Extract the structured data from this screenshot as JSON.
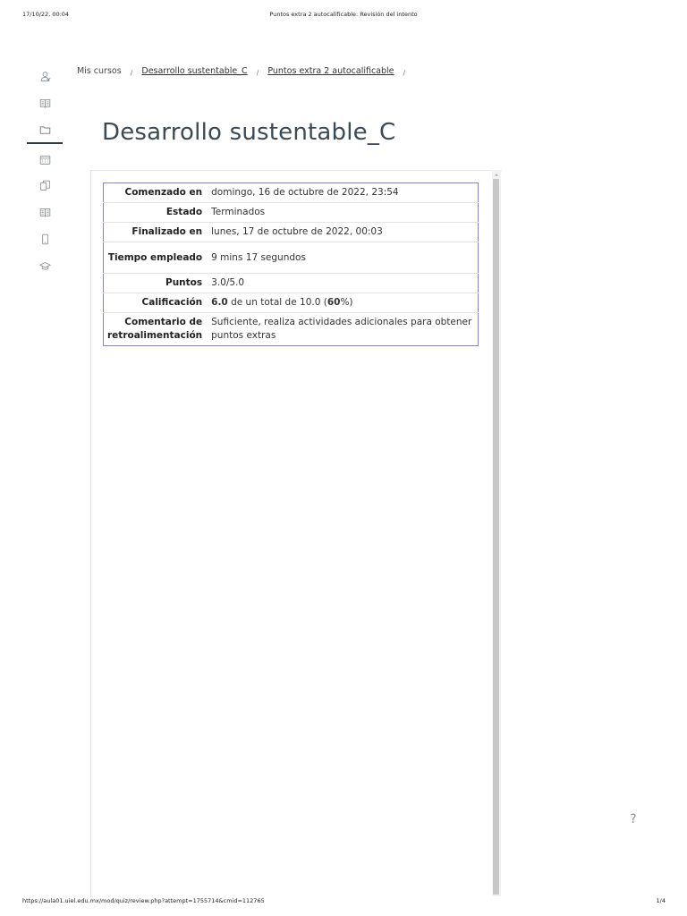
{
  "print": {
    "date": "17/10/22, 00:04",
    "title": "Puntos extra 2 autocalificable: Revisión del intento",
    "url": "https://aula01.uiel.edu.mx/mod/quiz/review.php?attempt=1755714&cmid=112765",
    "page": "1/4"
  },
  "nav": {
    "items": [
      {
        "icon": "participants-icon"
      },
      {
        "icon": "book-icon"
      },
      {
        "icon": "folder-icon",
        "active": true
      },
      {
        "icon": "calendar-icon"
      },
      {
        "icon": "files-icon"
      },
      {
        "icon": "open-book-icon"
      },
      {
        "icon": "mobile-icon"
      },
      {
        "icon": "graduation-cap-icon"
      }
    ]
  },
  "breadcrumb": {
    "items": [
      "Mis cursos",
      "Desarrollo sustentable_C",
      "Puntos extra 2 autocalificable"
    ],
    "separator": "/"
  },
  "page_title": "Desarrollo sustentable_C",
  "summary": {
    "started_label": "Comenzado en",
    "started_value": "domingo, 16 de octubre de 2022, 23:54",
    "state_label": "Estado",
    "state_value": "Terminados",
    "finished_label": "Finalizado en",
    "finished_value": "lunes, 17 de octubre de 2022, 00:03",
    "time_label": "Tiempo empleado",
    "time_value": "9 mins 17 segundos",
    "points_label": "Puntos",
    "points_value": "3.0/5.0",
    "grade_label": "Calificación",
    "grade_score": "6.0",
    "grade_middle": " de un total de 10.0 (",
    "grade_percent": "60",
    "grade_end": "%)",
    "feedback_label": "Comentario de retroalimentación",
    "feedback_value": " Suficiente, realiza actividades adicionales para obtener puntos extras"
  },
  "help": {
    "label": "?"
  },
  "colors": {
    "table_border": "#8c7fd6",
    "title": "#3b4a55",
    "rail_active": "#2b3d4a"
  }
}
